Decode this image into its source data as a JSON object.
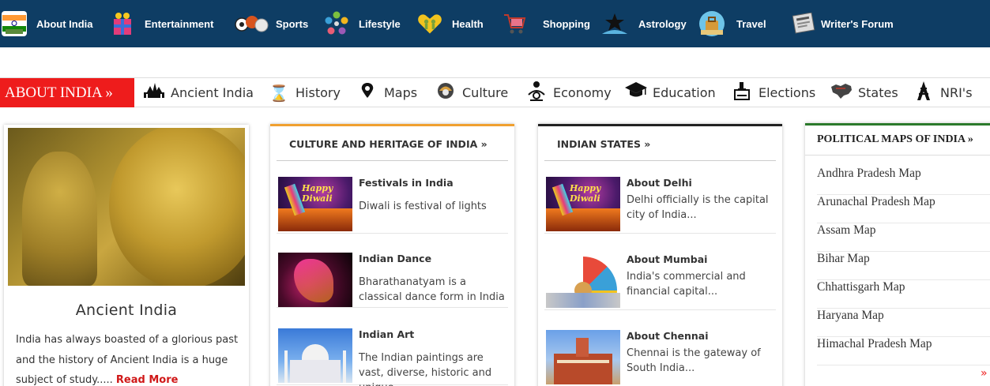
{
  "top_nav": [
    {
      "label": "About India",
      "icon": "india-flag-icon"
    },
    {
      "label": "Entertainment",
      "icon": "gift-box-icon"
    },
    {
      "label": "Sports",
      "icon": "sports-balls-icon"
    },
    {
      "label": "Lifestyle",
      "icon": "lifestyle-circles-icon"
    },
    {
      "label": "Health",
      "icon": "heart-people-icon"
    },
    {
      "label": "Shopping",
      "icon": "shopping-cart-icon"
    },
    {
      "label": "Astrology",
      "icon": "star-icon"
    },
    {
      "label": "Travel",
      "icon": "luggage-icon"
    },
    {
      "label": "Writer's Forum",
      "icon": "newspaper-icon"
    }
  ],
  "sub_nav": {
    "label": "ABOUT INDIA »",
    "items": [
      {
        "label": "Ancient India",
        "icon": "temple-icon"
      },
      {
        "label": "History",
        "icon": "hourglass-icon"
      },
      {
        "label": "Maps",
        "icon": "map-pin-icon"
      },
      {
        "label": "Culture",
        "icon": "culture-icon"
      },
      {
        "label": "Economy",
        "icon": "economy-icon"
      },
      {
        "label": "Education",
        "icon": "graduation-cap-icon"
      },
      {
        "label": "Elections",
        "icon": "ballot-box-icon"
      },
      {
        "label": "States",
        "icon": "india-map-icon"
      },
      {
        "label": "NRI's",
        "icon": "tower-icon"
      }
    ]
  },
  "ancient_card": {
    "title": "Ancient India",
    "description": "India has always boasted of a glorious past and the history of Ancient India is a huge subject of study..... ",
    "read_more": "Read More"
  },
  "culture": {
    "heading": "CULTURE AND HERITAGE OF INDIA »",
    "items": [
      {
        "title": "Festivals in India",
        "text": "Diwali is festival of lights",
        "thumb_text": "Happy Diwali"
      },
      {
        "title": "Indian Dance",
        "text": "Bharathanatyam is a classical dance form in India"
      },
      {
        "title": "Indian Art",
        "text": "The Indian paintings are vast, diverse, historic and unique"
      }
    ]
  },
  "states": {
    "heading": "INDIAN STATES »",
    "items": [
      {
        "title": "About Delhi",
        "text": "Delhi officially is the capital city of India...",
        "thumb_text": "Happy Diwali"
      },
      {
        "title": "About Mumbai",
        "text": "India's commercial and financial capital..."
      },
      {
        "title": "About Chennai",
        "text": "Chennai is the gateway of South India..."
      }
    ]
  },
  "maps": {
    "heading": "POLITICAL MAPS OF INDIA »",
    "items": [
      "Andhra Pradesh Map",
      "Arunachal Pradesh Map",
      "Assam Map",
      "Bihar Map",
      "Chhattisgarh Map",
      "Haryana Map",
      "Himachal Pradesh Map"
    ],
    "more": "»"
  },
  "colors": {
    "top_nav_bg": "#0e3d64",
    "accent_red": "#ee1c1c",
    "culture_border": "#f0a030",
    "states_border": "#222222",
    "maps_border": "#2b7a2b"
  }
}
